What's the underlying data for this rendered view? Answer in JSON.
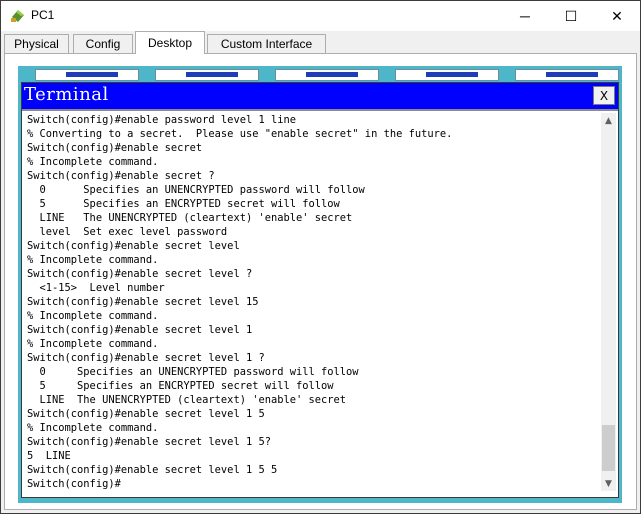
{
  "window": {
    "title": "PC1",
    "icon": "packet-tracer-pc-icon",
    "controls": {
      "minimize": "─",
      "maximize": "☐",
      "close": "✕"
    }
  },
  "tabs": [
    {
      "label": "Physical",
      "active": false
    },
    {
      "label": "Config",
      "active": false
    },
    {
      "label": "Desktop",
      "active": true
    },
    {
      "label": "Custom Interface",
      "active": false
    }
  ],
  "terminal": {
    "title": "Terminal",
    "close_label": "X",
    "lines": [
      "Switch(config)#enable password level 1 line",
      "% Converting to a secret.  Please use \"enable secret\" in the future.",
      "Switch(config)#enable secret",
      "% Incomplete command.",
      "Switch(config)#enable secret ?",
      "  0      Specifies an UNENCRYPTED password will follow",
      "  5      Specifies an ENCRYPTED secret will follow",
      "  LINE   The UNENCRYPTED (cleartext) 'enable' secret",
      "  level  Set exec level password",
      "Switch(config)#enable secret level",
      "% Incomplete command.",
      "Switch(config)#enable secret level ?",
      "  <1-15>  Level number",
      "Switch(config)#enable secret level 15",
      "% Incomplete command.",
      "Switch(config)#enable secret level 1",
      "% Incomplete command.",
      "Switch(config)#enable secret level 1 ?",
      "  0     Specifies an UNENCRYPTED password will follow",
      "  5     Specifies an ENCRYPTED secret will follow",
      "  LINE  The UNENCRYPTED (cleartext) 'enable' secret",
      "Switch(config)#enable secret level 1 5",
      "% Incomplete command.",
      "Switch(config)#enable secret level 1 5?",
      "5  LINE",
      "Switch(config)#enable secret level 1 5 5",
      "Switch(config)#"
    ]
  },
  "colors": {
    "terminal_title_bg": "#0000ff",
    "desktop_bg": "#4db6c8"
  }
}
